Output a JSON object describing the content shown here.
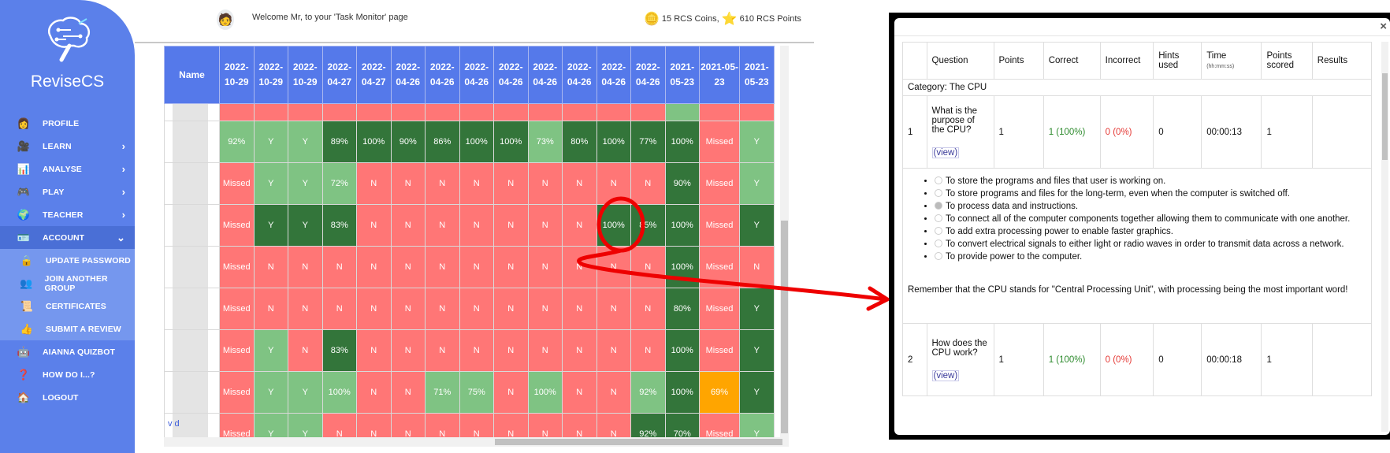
{
  "sidebar": {
    "brand": "ReviseCS",
    "items": [
      {
        "label": "PROFILE",
        "icon": "profile-icon",
        "glyph": "👩",
        "chevron": ""
      },
      {
        "label": "LEARN",
        "icon": "learn-icon",
        "glyph": "🎥",
        "chevron": "›"
      },
      {
        "label": "ANALYSE",
        "icon": "analyse-icon",
        "glyph": "📊",
        "chevron": "›"
      },
      {
        "label": "PLAY",
        "icon": "play-icon",
        "glyph": "🎮",
        "chevron": "›"
      },
      {
        "label": "TEACHER",
        "icon": "teacher-icon",
        "glyph": "🌍",
        "chevron": "›"
      },
      {
        "label": "ACCOUNT",
        "icon": "account-icon",
        "glyph": "🪪",
        "chevron": "⌄"
      }
    ],
    "account_sub": [
      {
        "label": "UPDATE PASSWORD",
        "icon": "lock-icon",
        "glyph": "🔒"
      },
      {
        "label": "JOIN ANOTHER GROUP",
        "icon": "group-icon",
        "glyph": "👥"
      },
      {
        "label": "CERTIFICATES",
        "icon": "certificate-icon",
        "glyph": "📜"
      },
      {
        "label": "SUBMIT A REVIEW",
        "icon": "review-icon",
        "glyph": "👍"
      }
    ],
    "bottom": [
      {
        "label": "AIANNA QUIZBOT",
        "icon": "quizbot-icon",
        "glyph": "🤖"
      },
      {
        "label": "HOW DO I...?",
        "icon": "help-icon",
        "glyph": "❓"
      },
      {
        "label": "LOGOUT",
        "icon": "logout-icon",
        "glyph": "🏠"
      }
    ]
  },
  "header": {
    "welcome": "Welcome Mr, to your 'Task Monitor' page",
    "coins": "15 RCS Coins,",
    "points": "610 RCS Points"
  },
  "grid": {
    "name_header": "Name",
    "columns": [
      "2022-10-29",
      "2022-10-29",
      "2022-10-29",
      "2022-04-27",
      "2022-04-27",
      "2022-04-26",
      "2022-04-26",
      "2022-04-26",
      "2022-04-26",
      "2022-04-26",
      "2022-04-26",
      "2022-04-26",
      "2022-04-26",
      "2021-05-23",
      "2021-05-23",
      "2021-05-23"
    ],
    "partial_row": [
      "R",
      "R",
      "R",
      "R",
      "R",
      "R",
      "R",
      "R",
      "R",
      "R",
      "R",
      "R",
      "R",
      "L",
      "R",
      "R"
    ],
    "rows": [
      {
        "cells": [
          [
            "92%",
            "L"
          ],
          [
            "Y",
            "L"
          ],
          [
            "Y",
            "L"
          ],
          [
            "89%",
            "D"
          ],
          [
            "100%",
            "D"
          ],
          [
            "90%",
            "D"
          ],
          [
            "86%",
            "D"
          ],
          [
            "100%",
            "D"
          ],
          [
            "100%",
            "D"
          ],
          [
            "73%",
            "L"
          ],
          [
            "80%",
            "D"
          ],
          [
            "100%",
            "D"
          ],
          [
            "77%",
            "D"
          ],
          [
            "100%",
            "D"
          ],
          [
            "Missed",
            "R"
          ],
          [
            "Y",
            "L"
          ]
        ]
      },
      {
        "cells": [
          [
            "Missed",
            "R"
          ],
          [
            "Y",
            "L"
          ],
          [
            "Y",
            "L"
          ],
          [
            "72%",
            "L"
          ],
          [
            "N",
            "R"
          ],
          [
            "N",
            "R"
          ],
          [
            "N",
            "R"
          ],
          [
            "N",
            "R"
          ],
          [
            "N",
            "R"
          ],
          [
            "N",
            "R"
          ],
          [
            "N",
            "R"
          ],
          [
            "N",
            "R"
          ],
          [
            "N",
            "R"
          ],
          [
            "90%",
            "D"
          ],
          [
            "Missed",
            "R"
          ],
          [
            "Y",
            "L"
          ]
        ]
      },
      {
        "cells": [
          [
            "Missed",
            "R"
          ],
          [
            "Y",
            "D"
          ],
          [
            "Y",
            "D"
          ],
          [
            "83%",
            "D"
          ],
          [
            "N",
            "R"
          ],
          [
            "N",
            "R"
          ],
          [
            "N",
            "R"
          ],
          [
            "N",
            "R"
          ],
          [
            "N",
            "R"
          ],
          [
            "N",
            "R"
          ],
          [
            "N",
            "R"
          ],
          [
            "100%",
            "D"
          ],
          [
            "85%",
            "D"
          ],
          [
            "100%",
            "D"
          ],
          [
            "Missed",
            "R"
          ],
          [
            "Y",
            "D"
          ]
        ]
      },
      {
        "cells": [
          [
            "Missed",
            "R"
          ],
          [
            "N",
            "R"
          ],
          [
            "N",
            "R"
          ],
          [
            "N",
            "R"
          ],
          [
            "N",
            "R"
          ],
          [
            "N",
            "R"
          ],
          [
            "N",
            "R"
          ],
          [
            "N",
            "R"
          ],
          [
            "N",
            "R"
          ],
          [
            "N",
            "R"
          ],
          [
            "N",
            "R"
          ],
          [
            "N",
            "R"
          ],
          [
            "N",
            "R"
          ],
          [
            "100%",
            "D"
          ],
          [
            "Missed",
            "R"
          ],
          [
            "N",
            "R"
          ]
        ]
      },
      {
        "cells": [
          [
            "Missed",
            "R"
          ],
          [
            "N",
            "R"
          ],
          [
            "N",
            "R"
          ],
          [
            "N",
            "R"
          ],
          [
            "N",
            "R"
          ],
          [
            "N",
            "R"
          ],
          [
            "N",
            "R"
          ],
          [
            "N",
            "R"
          ],
          [
            "N",
            "R"
          ],
          [
            "N",
            "R"
          ],
          [
            "N",
            "R"
          ],
          [
            "N",
            "R"
          ],
          [
            "N",
            "R"
          ],
          [
            "80%",
            "D"
          ],
          [
            "Missed",
            "R"
          ],
          [
            "Y",
            "D"
          ]
        ]
      },
      {
        "cells": [
          [
            "Missed",
            "R"
          ],
          [
            "Y",
            "L"
          ],
          [
            "N",
            "R"
          ],
          [
            "83%",
            "D"
          ],
          [
            "N",
            "R"
          ],
          [
            "N",
            "R"
          ],
          [
            "N",
            "R"
          ],
          [
            "N",
            "R"
          ],
          [
            "N",
            "R"
          ],
          [
            "N",
            "R"
          ],
          [
            "N",
            "R"
          ],
          [
            "N",
            "R"
          ],
          [
            "N",
            "R"
          ],
          [
            "100%",
            "D"
          ],
          [
            "Missed",
            "R"
          ],
          [
            "Y",
            "D"
          ]
        ]
      },
      {
        "cells": [
          [
            "Missed",
            "R"
          ],
          [
            "Y",
            "L"
          ],
          [
            "Y",
            "L"
          ],
          [
            "100%",
            "L"
          ],
          [
            "N",
            "R"
          ],
          [
            "N",
            "R"
          ],
          [
            "71%",
            "L"
          ],
          [
            "75%",
            "L"
          ],
          [
            "N",
            "R"
          ],
          [
            "100%",
            "L"
          ],
          [
            "N",
            "R"
          ],
          [
            "N",
            "R"
          ],
          [
            "92%",
            "L"
          ],
          [
            "100%",
            "D"
          ],
          [
            "69%",
            "O"
          ],
          [
            "Y",
            "D"
          ]
        ]
      },
      {
        "cells": [
          [
            "Missed",
            "R"
          ],
          [
            "Y",
            "L"
          ],
          [
            "Y",
            "L"
          ],
          [
            "N",
            "R"
          ],
          [
            "N",
            "R"
          ],
          [
            "N",
            "R"
          ],
          [
            "N",
            "R"
          ],
          [
            "N",
            "R"
          ],
          [
            "N",
            "R"
          ],
          [
            "N",
            "R"
          ],
          [
            "N",
            "R"
          ],
          [
            "N",
            "R"
          ],
          [
            "92%",
            "D"
          ],
          [
            "70%",
            "D"
          ],
          [
            "Missed",
            "R"
          ],
          [
            "Y",
            "L"
          ]
        ]
      }
    ],
    "partial_link": "v        d"
  },
  "colors": {
    "missed_or_no": "#ff7676",
    "light_green": "#7fc383",
    "dark_green": "#33753a",
    "partial": "#ffa500",
    "header_blue": "#5579ea",
    "annotation_red": "#ee0000"
  },
  "modal": {
    "close": "×",
    "headers": [
      "",
      "Question",
      "Points",
      "Correct",
      "Incorrect",
      "Hints used",
      "Time",
      "Points scored",
      "Results"
    ],
    "time_unit": "(hh:mm:ss)",
    "category": "Category: The CPU",
    "view_label": "(view)",
    "questions": [
      {
        "num": "1",
        "question": "What is the purpose of the CPU?",
        "points": "1",
        "correct": "1 (100%)",
        "incorrect": "0 (0%)",
        "hints": "0",
        "time": "00:00:13",
        "scored": "1",
        "results": ""
      },
      {
        "num": "2",
        "question": "How does the CPU work?",
        "points": "1",
        "correct": "1 (100%)",
        "incorrect": "0 (0%)",
        "hints": "0",
        "time": "00:00:18",
        "scored": "1",
        "results": ""
      }
    ],
    "options": [
      {
        "text": "To store the programs and files that user is working on.",
        "selected": false
      },
      {
        "text": "To store programs and files for the long-term, even when the computer is switched off.",
        "selected": false
      },
      {
        "text": "To process data and instructions.",
        "selected": true
      },
      {
        "text": "To connect all of the computer components together allowing them to communicate with one another.",
        "selected": false
      },
      {
        "text": "To add extra processing power to enable faster graphics.",
        "selected": false
      },
      {
        "text": "To convert electrical signals to either light or radio waves in order to transmit data across a network.",
        "selected": false
      },
      {
        "text": "To provide power to the computer.",
        "selected": false
      }
    ],
    "explanation": "Remember that the CPU stands for \"Central Processing Unit\", with processing being the most important word!"
  }
}
